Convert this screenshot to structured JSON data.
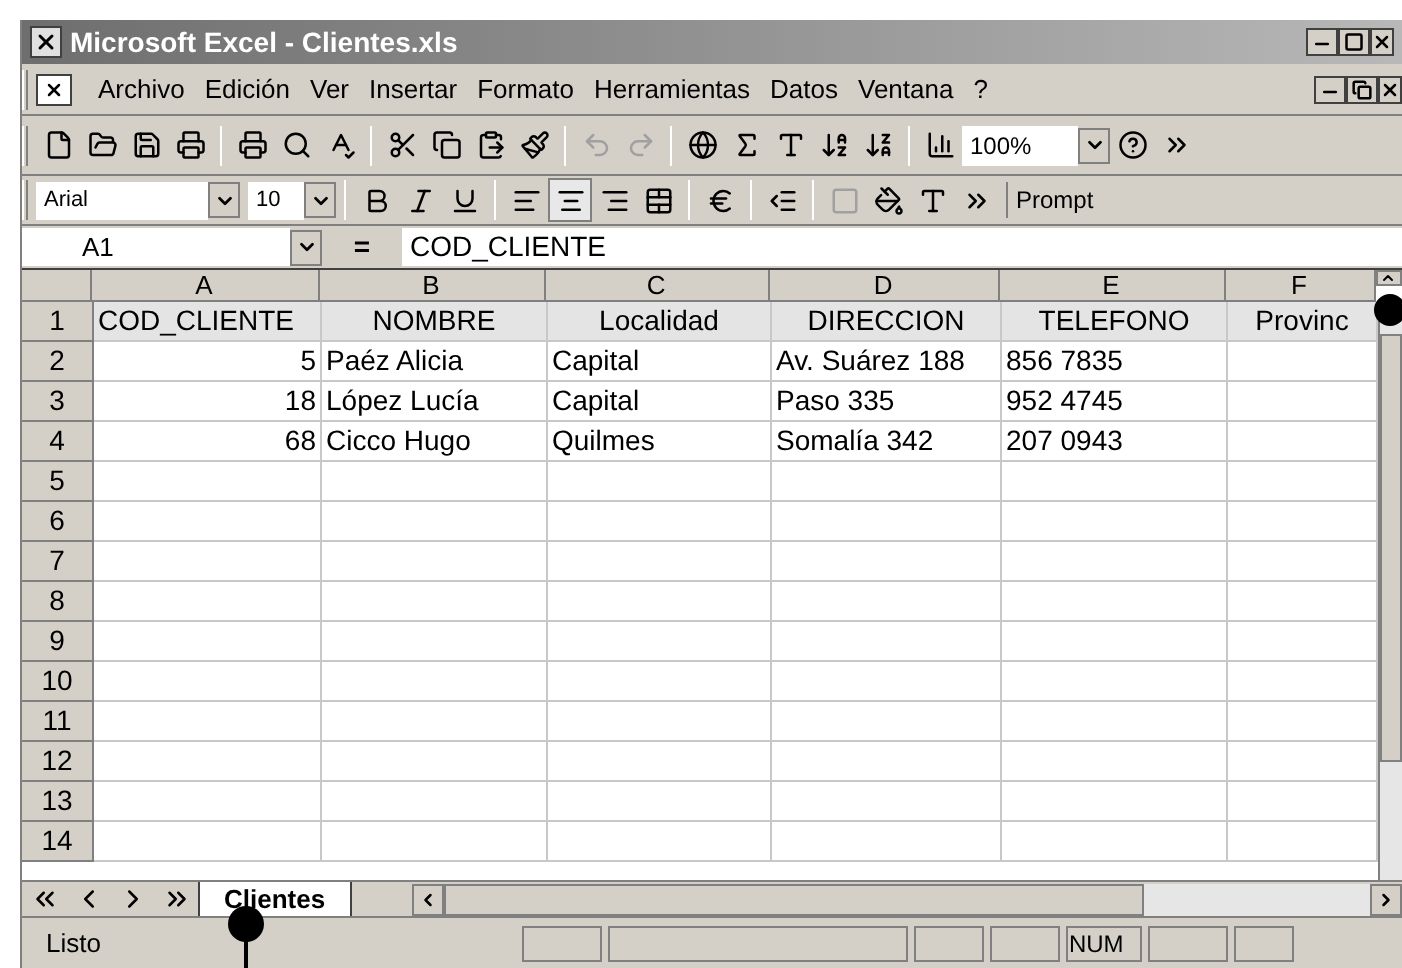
{
  "window": {
    "title": "Microsoft Excel - Clientes.xls"
  },
  "menu": [
    "Archivo",
    "Edición",
    "Ver",
    "Insertar",
    "Formato",
    "Herramientas",
    "Datos",
    "Ventana",
    "?"
  ],
  "standard_toolbar": {
    "zoom": "100%"
  },
  "formatting_toolbar": {
    "font": "Arial",
    "size": "10",
    "prompt": "Prompt"
  },
  "formula_bar": {
    "name_box": "A1",
    "equals": "=",
    "value": "COD_CLIENTE"
  },
  "table": {
    "columns": [
      "A",
      "B",
      "C",
      "D",
      "E",
      "F"
    ],
    "rows": [
      {
        "number": "1",
        "kind": "header",
        "cells": [
          "COD_CLIENTE",
          "NOMBRE",
          "Localidad",
          "DIRECCION",
          "TELEFONO",
          "Provinc"
        ]
      },
      {
        "number": "2",
        "kind": "data",
        "cells": [
          {
            "text": "5",
            "kind": "number"
          },
          {
            "text": "Paéz Alicia",
            "kind": "text"
          },
          {
            "text": "Capital",
            "kind": "text"
          },
          {
            "text": "Av. Suárez 188",
            "kind": "text"
          },
          {
            "text": "856 7835",
            "kind": "text"
          }
        ]
      },
      {
        "number": "3",
        "kind": "data",
        "cells": [
          {
            "text": "18",
            "kind": "number"
          },
          {
            "text": "López Lucía",
            "kind": "text"
          },
          {
            "text": "Capital",
            "kind": "text"
          },
          {
            "text": "Paso 335",
            "kind": "text"
          },
          {
            "text": "952 4745",
            "kind": "text"
          }
        ]
      },
      {
        "number": "4",
        "kind": "data",
        "cells": [
          {
            "text": "68",
            "kind": "number"
          },
          {
            "text": "Cicco Hugo",
            "kind": "text"
          },
          {
            "text": "Quilmes",
            "kind": "text"
          },
          {
            "text": "Somalía 342",
            "kind": "text"
          },
          {
            "text": "207 0943",
            "kind": "text"
          }
        ]
      },
      {
        "number": "5",
        "kind": "data"
      },
      {
        "number": "6",
        "kind": "data"
      },
      {
        "number": "7",
        "kind": "data"
      },
      {
        "number": "8",
        "kind": "data"
      },
      {
        "number": "9",
        "kind": "data"
      },
      {
        "number": "10",
        "kind": "data"
      },
      {
        "number": "11",
        "kind": "data"
      },
      {
        "number": "12",
        "kind": "data"
      },
      {
        "number": "13",
        "kind": "data"
      },
      {
        "number": "14",
        "kind": "data"
      }
    ]
  },
  "sheet_tabs": [
    {
      "label": "Clientes",
      "selected": true
    }
  ],
  "status_bar": {
    "text": "Listo",
    "indicator": "NUM"
  }
}
